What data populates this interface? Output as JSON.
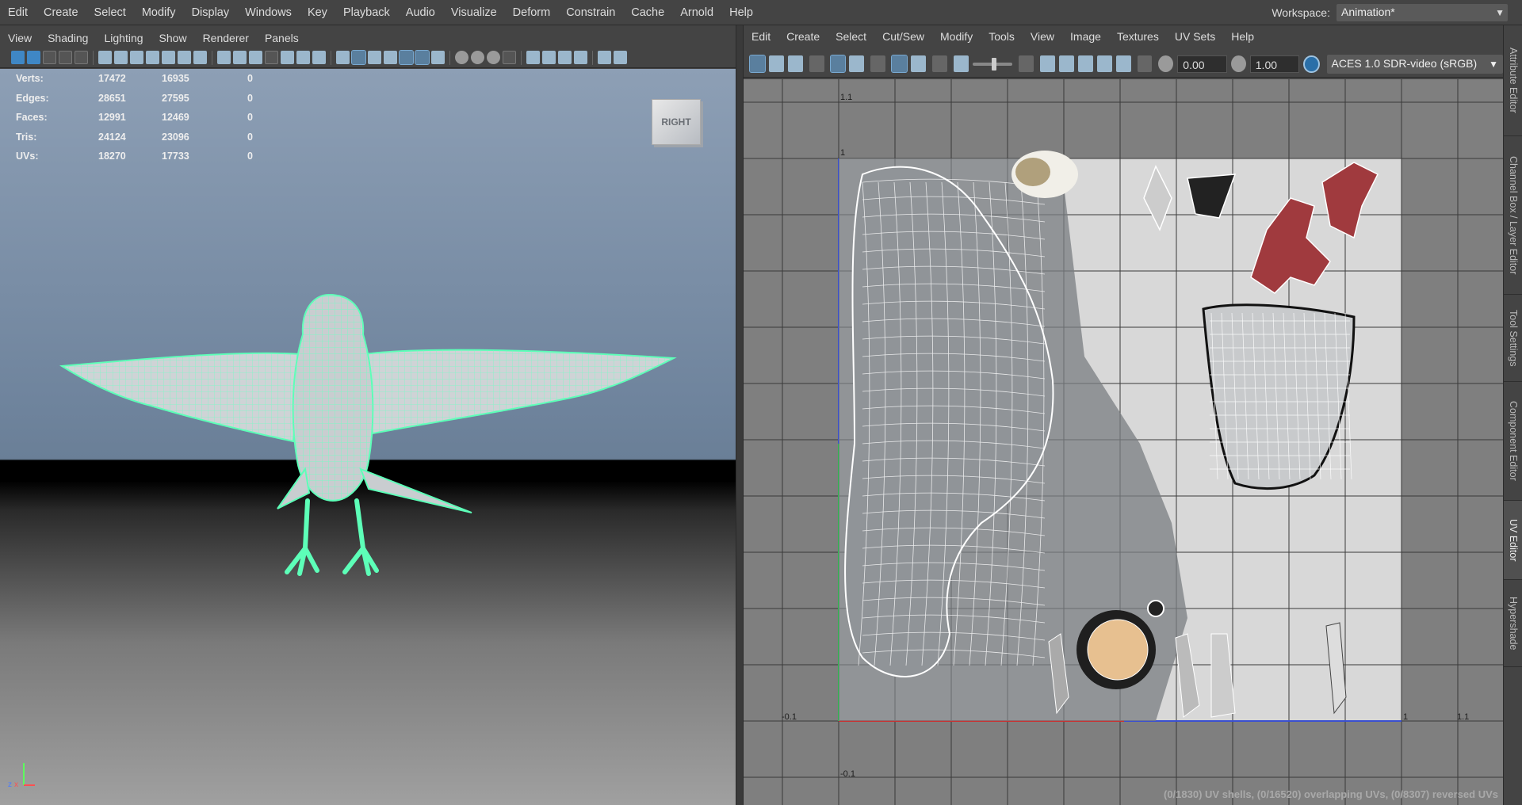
{
  "main_menu": [
    "Edit",
    "Create",
    "Select",
    "Modify",
    "Display",
    "Windows",
    "Key",
    "Playback",
    "Audio",
    "Visualize",
    "Deform",
    "Constrain",
    "Cache",
    "Arnold",
    "Help"
  ],
  "workspace": {
    "label": "Workspace:",
    "value": "Animation*"
  },
  "viewport": {
    "menu": [
      "View",
      "Shading",
      "Lighting",
      "Show",
      "Renderer",
      "Panels"
    ],
    "hud": [
      {
        "label": "Verts:",
        "v1": "17472",
        "v2": "16935",
        "v3": "0"
      },
      {
        "label": "Edges:",
        "v1": "28651",
        "v2": "27595",
        "v3": "0"
      },
      {
        "label": "Faces:",
        "v1": "12991",
        "v2": "12469",
        "v3": "0"
      },
      {
        "label": "Tris:",
        "v1": "24124",
        "v2": "23096",
        "v3": "0"
      },
      {
        "label": "UVs:",
        "v1": "18270",
        "v2": "17733",
        "v3": "0"
      }
    ],
    "viewcube_label": "RIGHT",
    "axis": {
      "z": "z",
      "x": "x"
    }
  },
  "uv_editor": {
    "menu": [
      "Edit",
      "Create",
      "Select",
      "Cut/Sew",
      "Modify",
      "Tools",
      "View",
      "Image",
      "Textures",
      "UV Sets",
      "Help"
    ],
    "exposure": "0.00",
    "gamma": "1.00",
    "color_space": "ACES 1.0 SDR-video (sRGB)",
    "grid_labels": {
      "top_v": "1.1",
      "v_one": "1",
      "left_u": "-0.1",
      "u_one": "1",
      "right_u": "1.1",
      "bottom_v": "-0.1"
    },
    "status": "(0/1830) UV shells, (0/16520) overlapping UVs, (0/8307) reversed UVs"
  },
  "side_tabs": [
    "Attribute Editor",
    "Channel Box / Layer Editor",
    "Tool Settings",
    "Component Editor",
    "UV Editor",
    "Hypershade"
  ]
}
